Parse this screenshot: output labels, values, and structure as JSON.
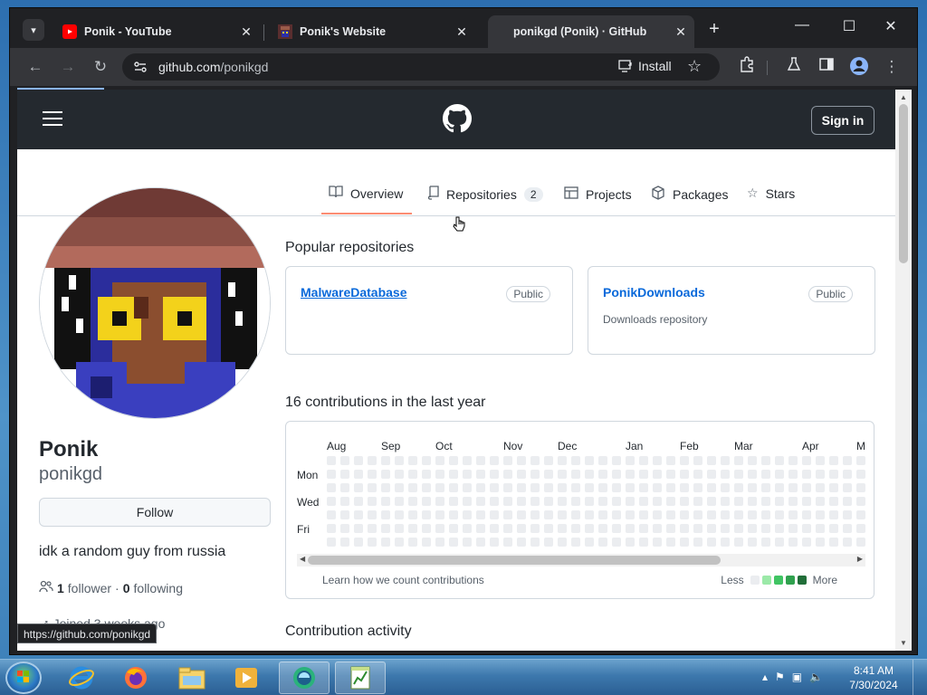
{
  "browser": {
    "tabs": [
      {
        "title": "Ponik - YouTube",
        "favicon": "youtube-icon",
        "active": false
      },
      {
        "title": "Ponik's Website",
        "favicon": "website-icon",
        "active": false
      },
      {
        "title": "ponikgd (Ponik) · GitHub",
        "favicon": "none",
        "active": true
      }
    ],
    "new_tab": "+",
    "window_controls": {
      "minimize": "—",
      "maximize": "☐",
      "close": "✕"
    },
    "url_host": "github.com",
    "url_path": "/ponikgd",
    "install_label": "Install",
    "status_url": "https://github.com/ponikgd"
  },
  "github": {
    "signin_label": "Sign in",
    "nav": [
      {
        "label": "Overview",
        "icon": "book-icon",
        "active": true
      },
      {
        "label": "Repositories",
        "icon": "repo-icon",
        "count": "2"
      },
      {
        "label": "Projects",
        "icon": "table-icon"
      },
      {
        "label": "Packages",
        "icon": "package-icon"
      },
      {
        "label": "Stars",
        "icon": "star-icon"
      }
    ],
    "profile": {
      "name": "Ponik",
      "login": "ponikgd",
      "follow_label": "Follow",
      "bio": "idk a random guy from russia",
      "followers_count": "1",
      "followers_label": "follower",
      "separator": "·",
      "following_count": "0",
      "following_label": "following",
      "joined": "Joined 3 weeks ago"
    },
    "popular_title": "Popular repositories",
    "repos": [
      {
        "name": "MalwareDatabase",
        "badge": "Public",
        "description": ""
      },
      {
        "name": "PonikDownloads",
        "badge": "Public",
        "description": "Downloads repository"
      }
    ],
    "contrib_title": "16 contributions in the last year",
    "months": [
      "Aug",
      "Sep",
      "Oct",
      "Nov",
      "Dec",
      "Jan",
      "Feb",
      "Mar",
      "Apr",
      "M"
    ],
    "days": [
      "Mon",
      "Wed",
      "Fri"
    ],
    "learn_label": "Learn how we count contributions",
    "legend_less": "Less",
    "legend_more": "More",
    "legend_colors": [
      "#ebedf0",
      "#9be9a8",
      "#40c463",
      "#30a14e",
      "#216e39"
    ],
    "activity_title": "Contribution activity"
  },
  "taskbar": {
    "time": "8:41 AM",
    "date": "7/30/2024"
  }
}
